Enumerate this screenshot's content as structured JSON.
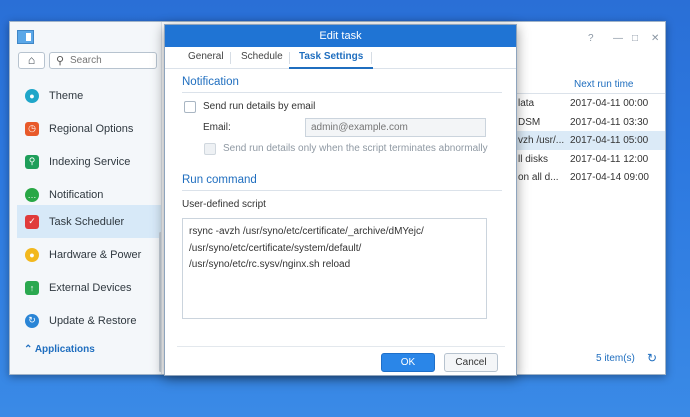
{
  "dialog": {
    "title": "Edit task",
    "tabs": [
      "General",
      "Schedule",
      "Task Settings"
    ],
    "active_tab": "Task Settings",
    "notification": {
      "section_title": "Notification",
      "send_email_label": "Send run details by email",
      "email_label": "Email:",
      "email_placeholder": "admin@example.com",
      "abnormal_only_label": "Send run details only when the script terminates abnormally"
    },
    "run_command": {
      "section_title": "Run command",
      "script_label": "User-defined script",
      "script_lines": [
        "rsync -avzh /usr/syno/etc/certificate/_archive/dMYejc/",
        "/usr/syno/etc/certificate/system/default/",
        "/usr/syno/etc/rc.sysv/nginx.sh reload"
      ]
    },
    "ok_label": "OK",
    "cancel_label": "Cancel"
  },
  "control_panel": {
    "search_placeholder": "Search",
    "nav_items": [
      {
        "label": "Theme",
        "icon": "palette-icon",
        "color": "#1fa6c9"
      },
      {
        "label": "Regional Options",
        "icon": "clock-icon",
        "color": "#e85a2a"
      },
      {
        "label": "Indexing Service",
        "icon": "magnifier-icon",
        "color": "#1e9e5a"
      },
      {
        "label": "Notification",
        "icon": "chat-bubble-icon",
        "color": "#28a745"
      },
      {
        "label": "Task Scheduler",
        "icon": "calendar-icon",
        "color": "#e03b3b"
      },
      {
        "label": "Hardware & Power",
        "icon": "bulb-icon",
        "color": "#f2b81e"
      },
      {
        "label": "External Devices",
        "icon": "upload-icon",
        "color": "#2aa84f"
      },
      {
        "label": "Update & Restore",
        "icon": "refresh-icon",
        "color": "#2a85d6"
      }
    ],
    "active_nav": "Task Scheduler",
    "applications_label": "Applications",
    "table": {
      "next_run_header": "Next run time",
      "rows": [
        {
          "task": "lata",
          "next_run": "2017-04-11 00:00"
        },
        {
          "task": "DSM",
          "next_run": "2017-04-11 03:30"
        },
        {
          "task": "vzh /usr/...",
          "next_run": "2017-04-11 05:00"
        },
        {
          "task": "ll disks",
          "next_run": "2017-04-11 12:00"
        },
        {
          "task": "on all d...",
          "next_run": "2017-04-14 09:00"
        }
      ],
      "selected_row": 2,
      "item_count": "5 item(s)"
    }
  },
  "colors": {
    "accent": "#1f6ebf",
    "title_bar": "#1f74d4",
    "desktop": "#2d79e0"
  }
}
